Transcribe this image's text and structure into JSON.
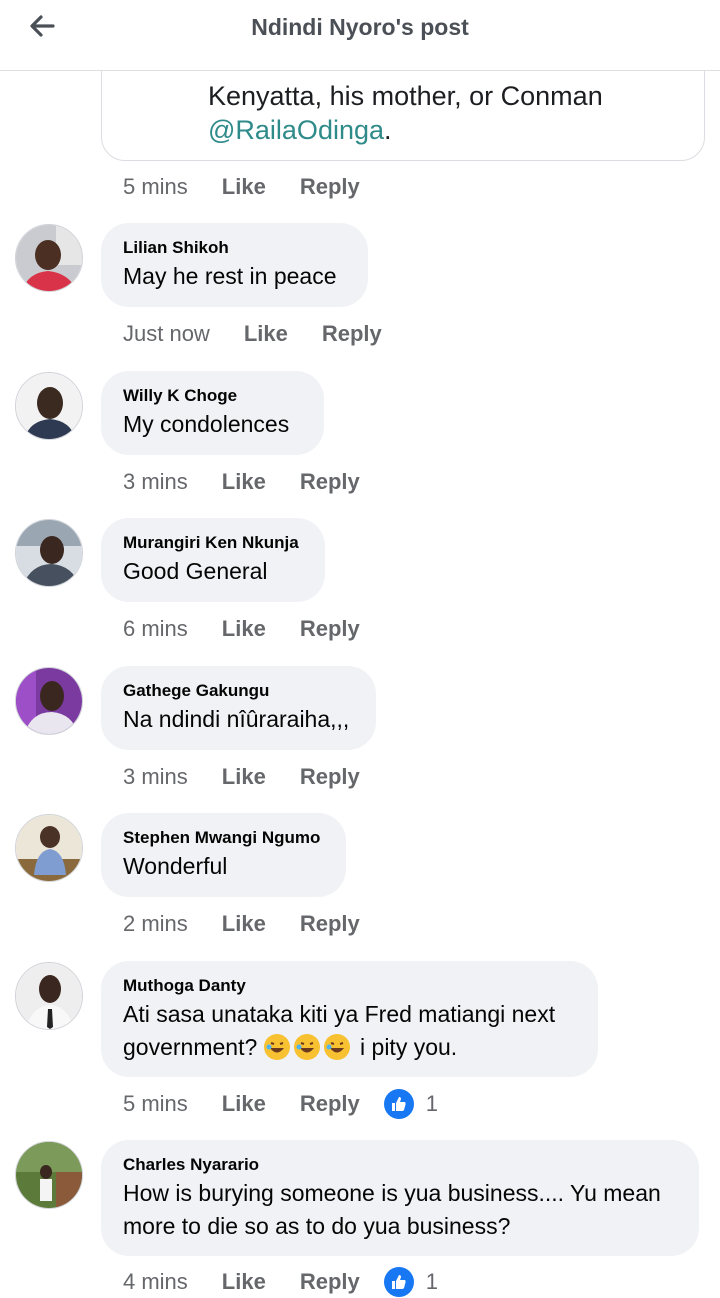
{
  "header": {
    "title": "Ndindi Nyoro's post",
    "back_icon": "arrow-left-icon"
  },
  "quoted_comment": {
    "line2": "Kenyatta, his mother, or Conman",
    "mention": "@RailaOdinga",
    "mention_suffix": ".",
    "mention_color": "#2f8a8a",
    "time": "5 mins",
    "like": "Like",
    "reply": "Reply"
  },
  "comments": [
    {
      "author": "Lilian Shikoh",
      "text": "May he rest in peace",
      "time": "Just now",
      "like": "Like",
      "reply": "Reply"
    },
    {
      "author": "Willy K Choge",
      "text": "My condolences",
      "time": "3 mins",
      "like": "Like",
      "reply": "Reply"
    },
    {
      "author": "Murangiri Ken Nkunja",
      "text": "Good General",
      "time": "6 mins",
      "like": "Like",
      "reply": "Reply"
    },
    {
      "author": "Gathege Gakungu",
      "text": "Na ndindi nîûraraiha,,,",
      "time": "3 mins",
      "like": "Like",
      "reply": "Reply"
    },
    {
      "author": "Stephen Mwangi Ngumo",
      "text": "Wonderful",
      "time": "2 mins",
      "like": "Like",
      "reply": "Reply"
    },
    {
      "author": "Muthoga Danty",
      "text_line1": "Ati sasa unataka kiti ya Fred matiangi next",
      "text_line2_before": "government?",
      "text_line2_after": "i pity you.",
      "time": "5 mins",
      "like": "Like",
      "reply": "Reply",
      "reaction_count": "1"
    },
    {
      "author": "Charles Nyarario",
      "text_line1": "How is burying someone is yua business.... Yu mean",
      "text_line2": "more to die so as to do yua business?",
      "time": "4 mins",
      "like": "Like",
      "reply": "Reply",
      "reaction_count": "1"
    }
  ],
  "colors": {
    "bubble": "#f0f2f5",
    "meta_text": "#65676b",
    "like_badge": "#1877f2"
  }
}
